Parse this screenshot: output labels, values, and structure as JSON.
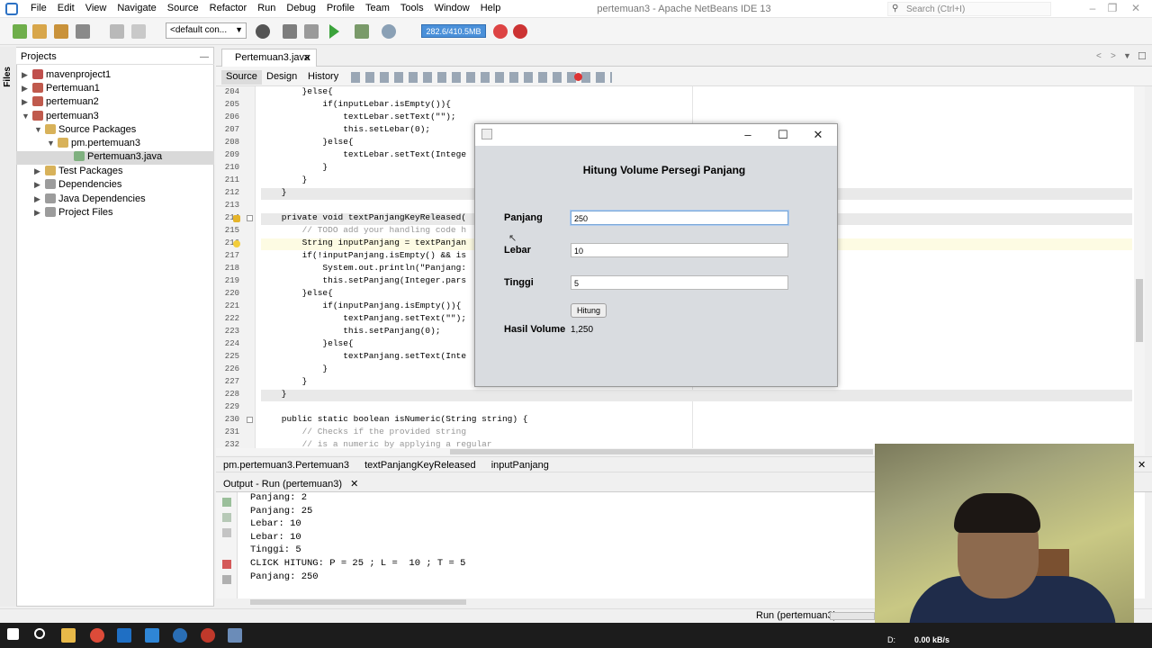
{
  "window": {
    "title": "pertemuan3 - Apache NetBeans IDE 13",
    "search_placeholder": "Search (Ctrl+I)"
  },
  "menu": [
    "File",
    "Edit",
    "View",
    "Navigate",
    "Source",
    "Refactor",
    "Run",
    "Debug",
    "Profile",
    "Team",
    "Tools",
    "Window",
    "Help"
  ],
  "toolbar": {
    "config_value": "<default con...",
    "memory": "282.6/410.5MB"
  },
  "projects": {
    "tab_label": "Projects",
    "files_label": "Files",
    "tree": [
      {
        "label": "mavenproject1"
      },
      {
        "label": "Pertemuan1"
      },
      {
        "label": "pertemuan2"
      },
      {
        "label": "pertemuan3"
      },
      {
        "label": "Source Packages"
      },
      {
        "label": "pm.pertemuan3"
      },
      {
        "label": "Pertemuan3.java"
      },
      {
        "label": "Test Packages"
      },
      {
        "label": "Dependencies"
      },
      {
        "label": "Java Dependencies"
      },
      {
        "label": "Project Files"
      }
    ]
  },
  "editor": {
    "file_tab": "Pertemuan3.java",
    "modes": [
      "Source",
      "Design",
      "History"
    ],
    "lines": [
      {
        "n": "204",
        "t": "        }else{"
      },
      {
        "n": "205",
        "t": "            if(inputLebar.isEmpty()){"
      },
      {
        "n": "206",
        "t": "                textLebar.setText(\"\");"
      },
      {
        "n": "207",
        "t": "                this.setLebar(0);"
      },
      {
        "n": "208",
        "t": "            }else{"
      },
      {
        "n": "209",
        "t": "                textLebar.setText(Intege"
      },
      {
        "n": "210",
        "t": "            }"
      },
      {
        "n": "211",
        "t": "        }"
      },
      {
        "n": "212",
        "t": "    }"
      },
      {
        "n": "213",
        "t": ""
      },
      {
        "n": "214",
        "t": "    private void textPanjangKeyReleased("
      },
      {
        "n": "215",
        "t": "        // TODO add your handling code h"
      },
      {
        "n": "216",
        "t": "        String inputPanjang = textPanjan"
      },
      {
        "n": "217",
        "t": "        if(!inputPanjang.isEmpty() && is"
      },
      {
        "n": "218",
        "t": "            System.out.println(\"Panjang:"
      },
      {
        "n": "219",
        "t": "            this.setPanjang(Integer.pars"
      },
      {
        "n": "220",
        "t": "        }else{"
      },
      {
        "n": "221",
        "t": "            if(inputPanjang.isEmpty()){"
      },
      {
        "n": "222",
        "t": "                textPanjang.setText(\"\");"
      },
      {
        "n": "223",
        "t": "                this.setPanjang(0);"
      },
      {
        "n": "224",
        "t": "            }else{"
      },
      {
        "n": "225",
        "t": "                textPanjang.setText(Inte"
      },
      {
        "n": "226",
        "t": "            }"
      },
      {
        "n": "227",
        "t": "        }"
      },
      {
        "n": "228",
        "t": "    }"
      },
      {
        "n": "229",
        "t": ""
      },
      {
        "n": "230",
        "t": "    public static boolean isNumeric(String string) {"
      },
      {
        "n": "231",
        "t": "        // Checks if the provided string"
      },
      {
        "n": "232",
        "t": "        // is a numeric by applying a regular"
      }
    ]
  },
  "breadcrumb": [
    "pm.pertemuan3.Pertemuan3",
    "textPanjangKeyReleased",
    "inputPanjang"
  ],
  "output": {
    "tab_label": "Output - Run (pertemuan3)",
    "lines": [
      "Panjang: 2",
      "Panjang: 25",
      "Lebar: 10",
      "Lebar: 10",
      "Tinggi: 5",
      "CLICK HITUNG: P = 25 ; L =  10 ; T = 5",
      "Panjang: 250"
    ]
  },
  "status": {
    "run_label": "Run (pertemuan3)"
  },
  "dialog": {
    "heading": "Hitung Volume Persegi Panjang",
    "panjang_label": "Panjang",
    "panjang_value": "250",
    "lebar_label": "Lebar",
    "lebar_value": "10",
    "tinggi_label": "Tinggi",
    "tinggi_value": "5",
    "button_label": "Hitung",
    "hasil_label": "Hasil Volume",
    "hasil_value": "1,250"
  },
  "taskbar": {
    "tray_drive": "D:",
    "net_speed": "0.00 kB/s"
  }
}
